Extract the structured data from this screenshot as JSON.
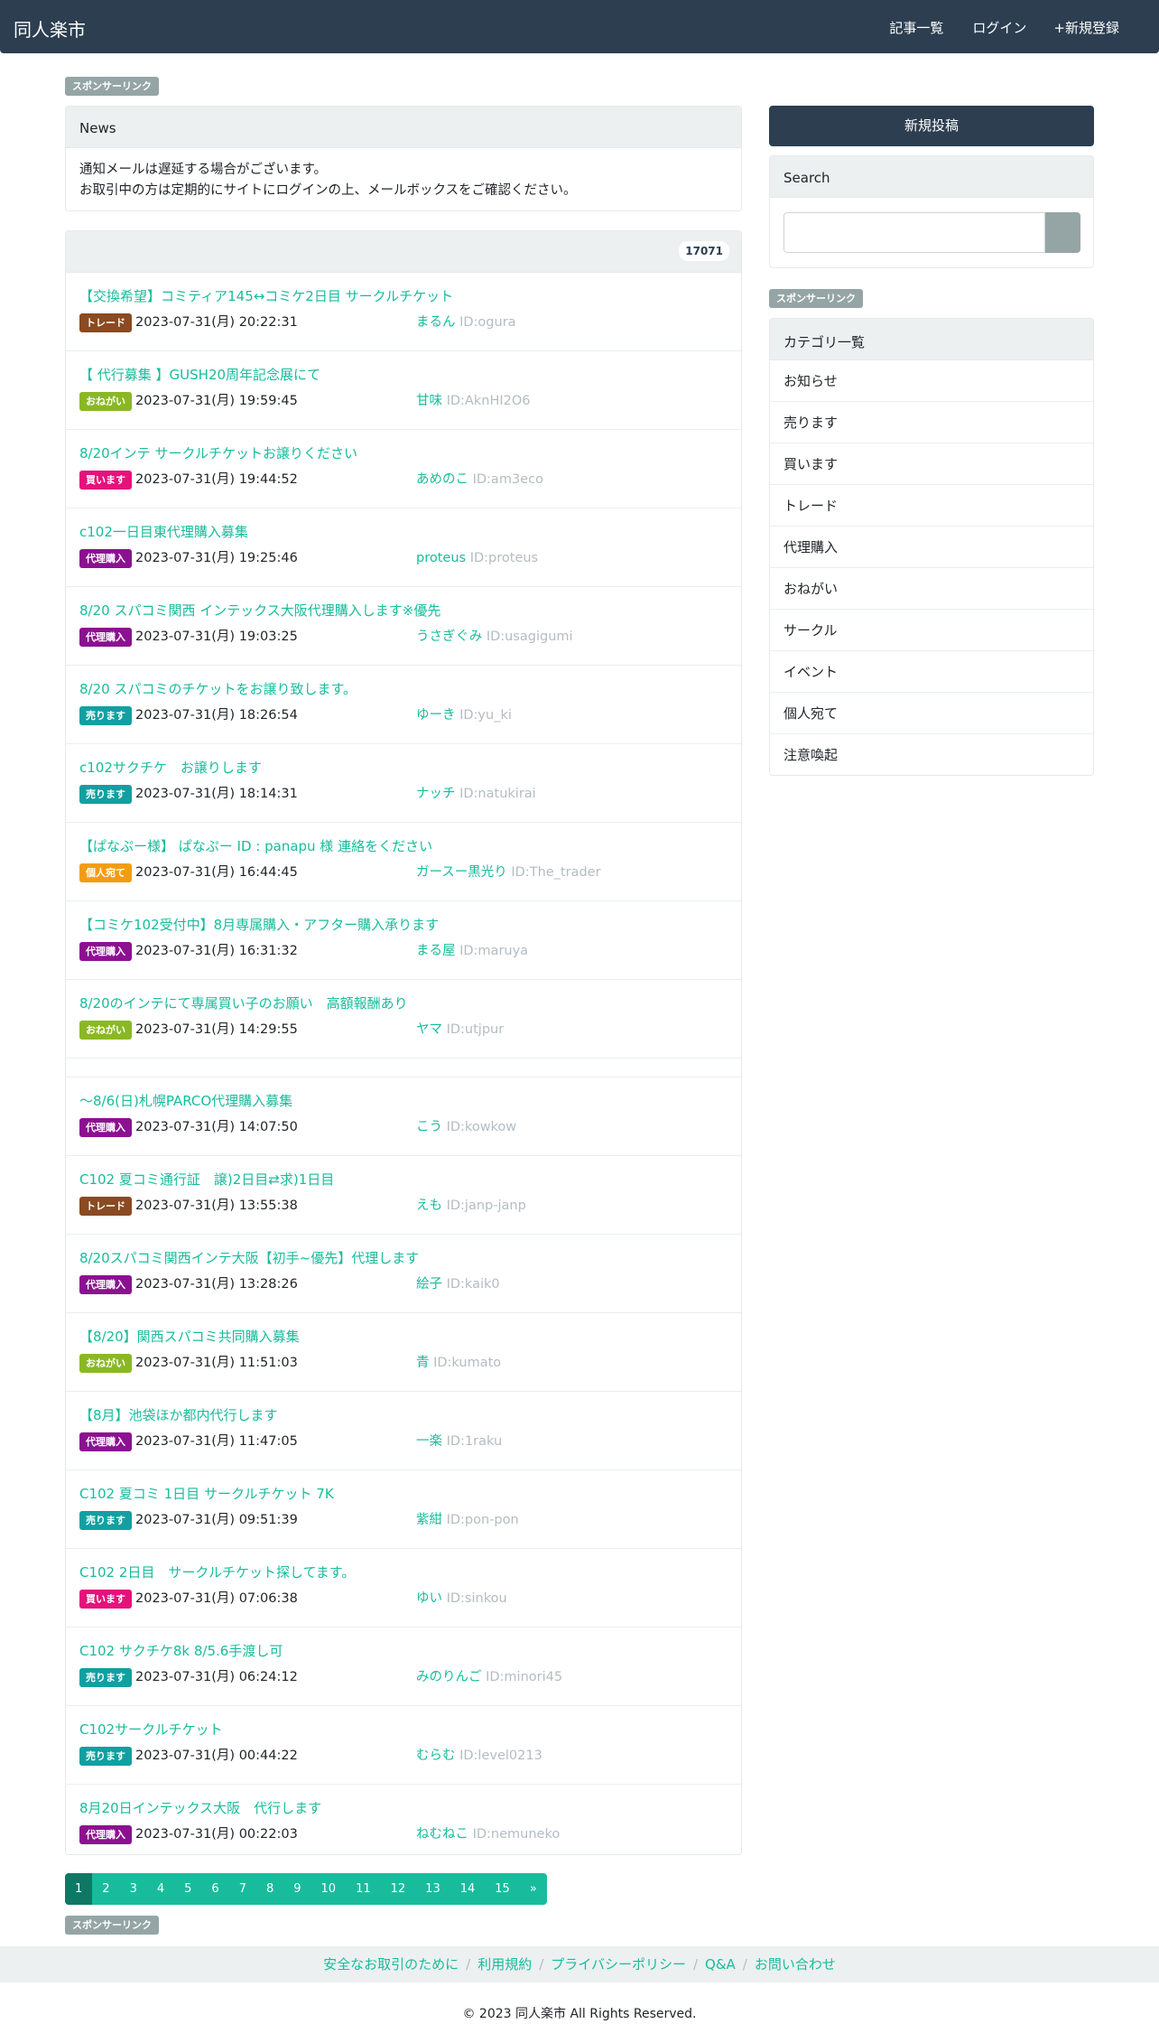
{
  "nav": {
    "brand": "同人楽市",
    "items": [
      {
        "icon": "",
        "label": "記事一覧"
      },
      {
        "icon": "",
        "label": "ログイン"
      },
      {
        "icon": "+",
        "label": "新規登録"
      }
    ]
  },
  "sponsor_label": "スポンサーリンク",
  "news": {
    "title": "News",
    "line1": "通知メールは遅延する場合がございます。",
    "line2": "お取引中の方は定期的にサイトにログインの上、メールボックスをご確認ください。"
  },
  "list": {
    "count": "17071",
    "colors": {
      "トレード": "#8a4a22",
      "おねがい": "#8ab825",
      "買います": "#e5127c",
      "代理購入": "#8b1191",
      "売ります": "#11a0a1",
      "個人宛て": "#f39c12"
    },
    "posts": [
      {
        "title": "【交換希望】コミティア145↔コミケ2日目 サークルチケット",
        "category": "トレード",
        "date": "2023-07-31(月) 20:22:31",
        "user": "まるん",
        "uid": "ID:ogura"
      },
      {
        "title": "【 代行募集 】GUSH20周年記念展にて",
        "category": "おねがい",
        "date": "2023-07-31(月) 19:59:45",
        "user": "甘味",
        "uid": "ID:AknHI2O6"
      },
      {
        "title": "8/20インテ サークルチケットお譲りください",
        "category": "買います",
        "date": "2023-07-31(月) 19:44:52",
        "user": "あめのこ",
        "uid": "ID:am3eco"
      },
      {
        "title": "c102一日目東代理購入募集",
        "category": "代理購入",
        "date": "2023-07-31(月) 19:25:46",
        "user": "proteus",
        "uid": "ID:proteus"
      },
      {
        "title": "8/20 スパコミ関西 インテックス大阪代理購入します※優先",
        "category": "代理購入",
        "date": "2023-07-31(月) 19:03:25",
        "user": "うさぎぐみ",
        "uid": "ID:usagigumi"
      },
      {
        "title": "8/20 スパコミのチケットをお譲り致します。",
        "category": "売ります",
        "date": "2023-07-31(月) 18:26:54",
        "user": "ゆーき",
        "uid": "ID:yu_ki"
      },
      {
        "title": "c102サクチケ　お譲りします",
        "category": "売ります",
        "date": "2023-07-31(月) 18:14:31",
        "user": "ナッチ",
        "uid": "ID:natukirai"
      },
      {
        "title": "【ぱなぷー様】 ぱなぷー ID : panapu 様 連絡をください",
        "category": "個人宛て",
        "date": "2023-07-31(月) 16:44:45",
        "user": "ガースー黒光り",
        "uid": "ID:The_trader"
      },
      {
        "title": "【コミケ102受付中】8月専属購入・アフター購入承ります",
        "category": "代理購入",
        "date": "2023-07-31(月) 16:31:32",
        "user": "まる屋",
        "uid": "ID:maruya"
      },
      {
        "title": "8/20のインテにて専属買い子のお願い　高額報酬あり",
        "category": "おねがい",
        "date": "2023-07-31(月) 14:29:55",
        "user": "ヤマ",
        "uid": "ID:utjpur"
      },
      {
        "title": "〜8/6(日)札幌PARCO代理購入募集",
        "category": "代理購入",
        "date": "2023-07-31(月) 14:07:50",
        "user": "こう",
        "uid": "ID:kowkow"
      },
      {
        "title": "C102 夏コミ通行証　譲)2日目⇄求)1日目",
        "category": "トレード",
        "date": "2023-07-31(月) 13:55:38",
        "user": "えも",
        "uid": "ID:janp-janp"
      },
      {
        "title": "8/20スパコミ関西インテ大阪【初手~優先】代理します",
        "category": "代理購入",
        "date": "2023-07-31(月) 13:28:26",
        "user": "絵子",
        "uid": "ID:kaik0"
      },
      {
        "title": "【8/20】関西スパコミ共同購入募集",
        "category": "おねがい",
        "date": "2023-07-31(月) 11:51:03",
        "user": "青",
        "uid": "ID:kumato"
      },
      {
        "title": "【8月】池袋ほか都内代行します",
        "category": "代理購入",
        "date": "2023-07-31(月) 11:47:05",
        "user": "一楽",
        "uid": "ID:1raku"
      },
      {
        "title": "C102 夏コミ 1日目 サークルチケット 7K",
        "category": "売ります",
        "date": "2023-07-31(月) 09:51:39",
        "user": "紫紺",
        "uid": "ID:pon-pon"
      },
      {
        "title": "C102 2日目　サークルチケット探してます。",
        "category": "買います",
        "date": "2023-07-31(月) 07:06:38",
        "user": "ゆい",
        "uid": "ID:sinkou"
      },
      {
        "title": "C102 サクチケ8k 8/5.6手渡し可",
        "category": "売ります",
        "date": "2023-07-31(月) 06:24:12",
        "user": "みのりんご",
        "uid": "ID:minori45"
      },
      {
        "title": "C102サークルチケット",
        "category": "売ります",
        "date": "2023-07-31(月) 00:44:22",
        "user": "むらむ",
        "uid": "ID:level0213"
      },
      {
        "title": "8月20日インテックス大阪　代行します",
        "category": "代理購入",
        "date": "2023-07-31(月) 00:22:03",
        "user": "ねむねこ",
        "uid": "ID:nemuneko"
      }
    ]
  },
  "pagination": {
    "current": "1",
    "pages": [
      "1",
      "2",
      "3",
      "4",
      "5",
      "6",
      "7",
      "8",
      "9",
      "10",
      "11",
      "12",
      "13",
      "14",
      "15",
      "»"
    ]
  },
  "sidebar": {
    "new_post": "新規投稿",
    "search_title": "Search",
    "search_button_icon": "",
    "categories_title": "カテゴリ一覧",
    "categories": [
      "お知らせ",
      "売ります",
      "買います",
      "トレード",
      "代理購入",
      "おねがい",
      "サークル",
      "イベント",
      "個人宛て",
      "注意喚起"
    ]
  },
  "footer": {
    "links": [
      "安全なお取引のために",
      "利用規約",
      "プライバシーポリシー",
      "Q&A",
      "お問い合わせ"
    ],
    "copyright": "© 2023 同人楽市 All Rights Reserved."
  }
}
